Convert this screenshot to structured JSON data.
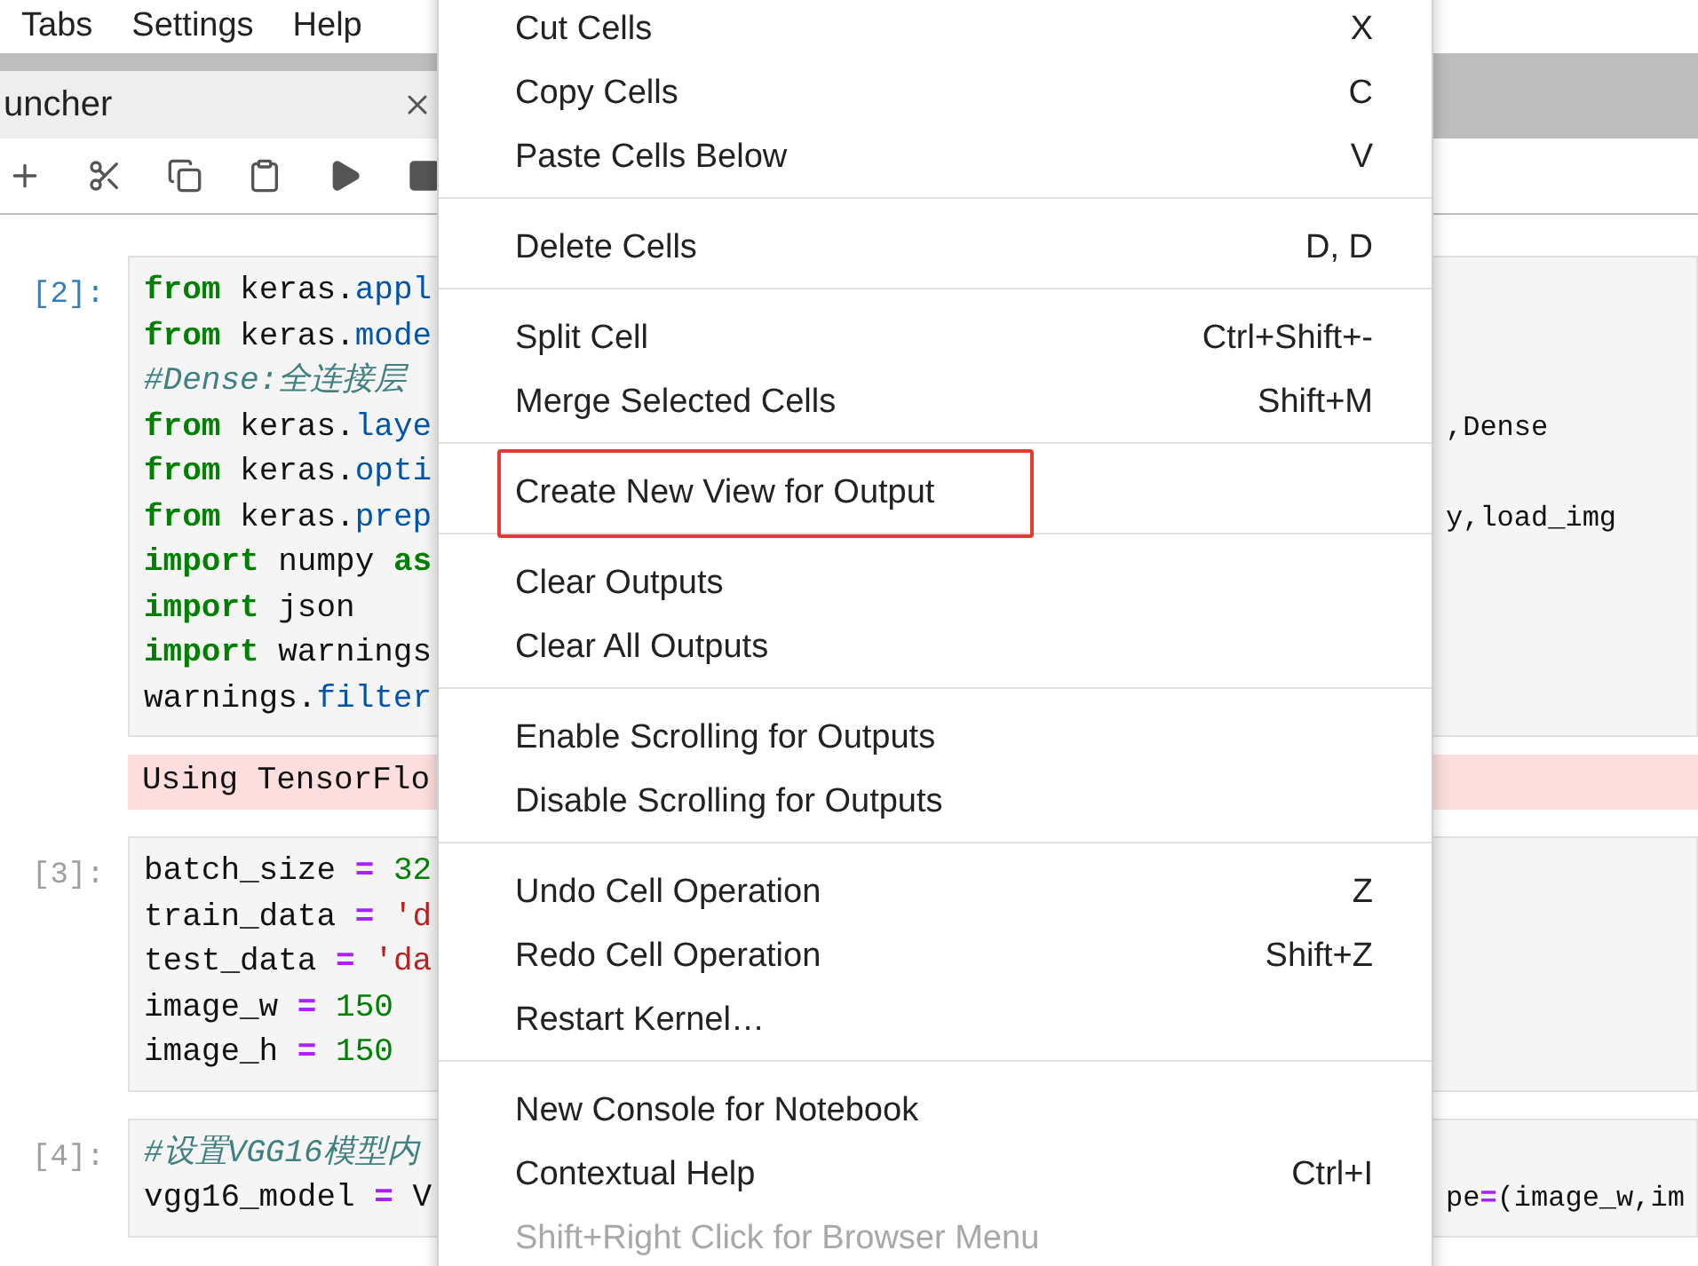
{
  "menu_bar": [
    "Tabs",
    "Settings",
    "Help"
  ],
  "tabs": [
    {
      "label": "uncher",
      "selected": true
    }
  ],
  "cells": [
    {
      "prompt": "[2]:",
      "selected": true,
      "lines": [
        {
          "tokens": [
            {
              "kind": "keyword",
              "text": "from"
            },
            {
              "kind": "plain",
              "text": " keras."
            },
            {
              "kind": "module",
              "text": "appl"
            }
          ]
        },
        {
          "tokens": [
            {
              "kind": "keyword",
              "text": "from"
            },
            {
              "kind": "plain",
              "text": " keras."
            },
            {
              "kind": "module",
              "text": "mode"
            }
          ]
        },
        {
          "tokens": [
            {
              "kind": "comment",
              "text": "#Dense:全连接层"
            }
          ]
        },
        {
          "tokens": [
            {
              "kind": "keyword",
              "text": "from"
            },
            {
              "kind": "plain",
              "text": " keras."
            },
            {
              "kind": "module",
              "text": "laye"
            }
          ],
          "right": [
            {
              "kind": "plain",
              "text": ",Dense"
            }
          ]
        },
        {
          "tokens": [
            {
              "kind": "keyword",
              "text": "from"
            },
            {
              "kind": "plain",
              "text": " keras."
            },
            {
              "kind": "module",
              "text": "opti"
            }
          ]
        },
        {
          "tokens": [
            {
              "kind": "keyword",
              "text": "from"
            },
            {
              "kind": "plain",
              "text": " keras."
            },
            {
              "kind": "module",
              "text": "prep"
            }
          ],
          "right": [
            {
              "kind": "plain",
              "text": "y,load_img"
            }
          ]
        },
        {
          "tokens": [
            {
              "kind": "keyword",
              "text": "import"
            },
            {
              "kind": "plain",
              "text": " numpy "
            },
            {
              "kind": "keyword",
              "text": "as"
            }
          ]
        },
        {
          "tokens": [
            {
              "kind": "keyword",
              "text": "import"
            },
            {
              "kind": "plain",
              "text": " json"
            }
          ]
        },
        {
          "tokens": [
            {
              "kind": "keyword",
              "text": "import"
            },
            {
              "kind": "plain",
              "text": " warnings"
            }
          ]
        },
        {
          "tokens": [
            {
              "kind": "plain",
              "text": "warnings."
            },
            {
              "kind": "module",
              "text": "filter"
            }
          ]
        }
      ],
      "output": {
        "kind": "stderr",
        "text": "Using TensorFlo"
      }
    },
    {
      "prompt": "[3]:",
      "selected": false,
      "lines": [
        {
          "tokens": [
            {
              "kind": "plain",
              "text": "batch_size "
            },
            {
              "kind": "operator",
              "text": "="
            },
            {
              "kind": "number",
              "text": " 32"
            }
          ]
        },
        {
          "tokens": [
            {
              "kind": "plain",
              "text": "train_data "
            },
            {
              "kind": "operator",
              "text": "="
            },
            {
              "kind": "string",
              "text": " 'd"
            }
          ]
        },
        {
          "tokens": [
            {
              "kind": "plain",
              "text": "test_data "
            },
            {
              "kind": "operator",
              "text": "="
            },
            {
              "kind": "string",
              "text": " 'da"
            }
          ]
        },
        {
          "tokens": [
            {
              "kind": "plain",
              "text": "image_w "
            },
            {
              "kind": "operator",
              "text": "="
            },
            {
              "kind": "number",
              "text": " 150"
            }
          ]
        },
        {
          "tokens": [
            {
              "kind": "plain",
              "text": "image_h "
            },
            {
              "kind": "operator",
              "text": "="
            },
            {
              "kind": "number",
              "text": " 150"
            }
          ]
        }
      ]
    },
    {
      "prompt": "[4]:",
      "selected": false,
      "lines": [
        {
          "tokens": [
            {
              "kind": "comment",
              "text": "#设置VGG16模型内"
            }
          ]
        },
        {
          "tokens": [
            {
              "kind": "plain",
              "text": "vgg16_model "
            },
            {
              "kind": "operator",
              "text": "="
            },
            {
              "kind": "plain",
              "text": " V"
            }
          ],
          "right": [
            {
              "kind": "plain",
              "text": "pe"
            },
            {
              "kind": "operator",
              "text": "="
            },
            {
              "kind": "plain",
              "text": "(image_w,im"
            }
          ]
        }
      ]
    }
  ],
  "context_menu": {
    "groups": [
      {
        "items": [
          {
            "label": "Cut Cells",
            "shortcut": "X",
            "disabled": false,
            "outlined": false
          },
          {
            "label": "Copy Cells",
            "shortcut": "C",
            "disabled": false,
            "outlined": false
          },
          {
            "label": "Paste Cells Below",
            "shortcut": "V",
            "disabled": false,
            "outlined": false
          }
        ]
      },
      {
        "items": [
          {
            "label": "Delete Cells",
            "shortcut": "D, D",
            "disabled": false,
            "outlined": false
          }
        ]
      },
      {
        "items": [
          {
            "label": "Split Cell",
            "shortcut": "Ctrl+Shift+-",
            "disabled": false,
            "outlined": false
          },
          {
            "label": "Merge Selected Cells",
            "shortcut": "Shift+M",
            "disabled": false,
            "outlined": false
          }
        ]
      },
      {
        "items": [
          {
            "label": "Create New View for Output",
            "disabled": false,
            "outlined": true
          }
        ]
      },
      {
        "items": [
          {
            "label": "Clear Outputs",
            "disabled": false,
            "outlined": false
          },
          {
            "label": "Clear All Outputs",
            "disabled": false,
            "outlined": false
          }
        ]
      },
      {
        "items": [
          {
            "label": "Enable Scrolling for Outputs",
            "disabled": false,
            "outlined": false
          },
          {
            "label": "Disable Scrolling for Outputs",
            "disabled": false,
            "outlined": false
          }
        ]
      },
      {
        "items": [
          {
            "label": "Undo Cell Operation",
            "shortcut": "Z",
            "disabled": false,
            "outlined": false
          },
          {
            "label": "Redo Cell Operation",
            "shortcut": "Shift+Z",
            "disabled": false,
            "outlined": false
          },
          {
            "label": "Restart Kernel…",
            "disabled": false,
            "outlined": false
          }
        ]
      },
      {
        "items": [
          {
            "label": "New Console for Notebook",
            "disabled": false,
            "outlined": false
          },
          {
            "label": "Contextual Help",
            "shortcut": "Ctrl+I",
            "disabled": false,
            "outlined": false
          },
          {
            "label": "Shift+Right Click for Browser Menu",
            "disabled": true,
            "outlined": false
          }
        ]
      }
    ]
  }
}
